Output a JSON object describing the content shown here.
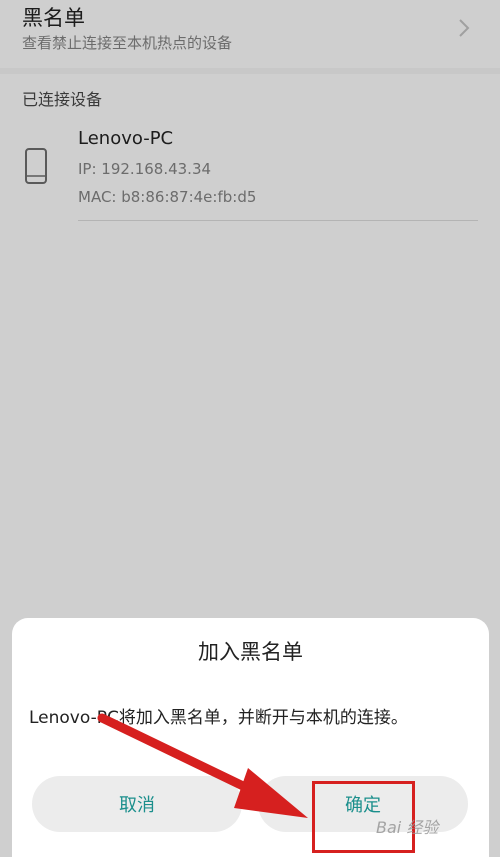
{
  "blacklist": {
    "title": "黑名单",
    "subtitle": "查看禁止连接至本机热点的设备"
  },
  "connected_section": {
    "header": "已连接设备",
    "device": {
      "name": "Lenovo-PC",
      "ip": "IP: 192.168.43.34",
      "mac": "MAC: b8:86:87:4e:fb:d5"
    }
  },
  "dialog": {
    "title": "加入黑名单",
    "message": "Lenovo-PC将加入黑名单，并断开与本机的连接。",
    "cancel_label": "取消",
    "confirm_label": "确定"
  },
  "watermark": "Bai 经验",
  "colors": {
    "accent": "#1b8f8c",
    "annotation": "#d6201f",
    "background": "#cfcfcf"
  }
}
